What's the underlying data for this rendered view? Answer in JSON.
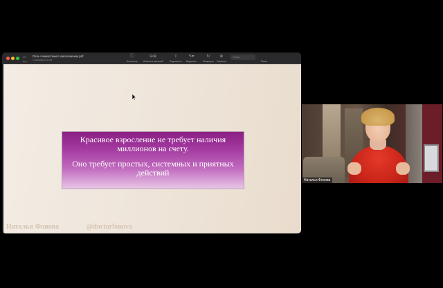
{
  "toolbar": {
    "sidebar_label": "Вид",
    "doc_title": "Роль гимнастики в омоложении.pdf",
    "doc_subtitle": "Страница 6 из 36",
    "tools": [
      {
        "icon": "info-icon",
        "label": "Инспектор"
      },
      {
        "icon": "zoom-icon",
        "label": "Изменить масштаб"
      },
      {
        "icon": "share-icon",
        "label": "Поделиться"
      },
      {
        "icon": "highlight-icon",
        "label": "Выделить"
      },
      {
        "icon": "rotate-icon",
        "label": "Повернуть"
      },
      {
        "icon": "markup-icon",
        "label": "Разметка"
      }
    ],
    "search_placeholder": "Поиск",
    "search_label": "Поиск"
  },
  "slide": {
    "banner_line1": "Красивое взросление не требует наличия миллионов на счету.",
    "banner_line2": "Оно требует простых, системных и приятных действий",
    "footer_name": "Наталья Фонова",
    "footer_handle": "@doctorfonova"
  },
  "webcam": {
    "participant_name": "Наталья Фонова"
  }
}
